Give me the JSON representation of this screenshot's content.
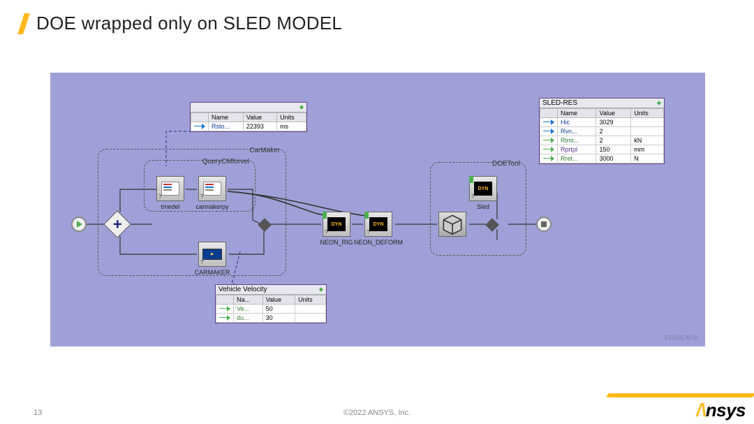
{
  "title": "DOE wrapped only on SLED MODEL",
  "footer": {
    "page": "13",
    "copy": "©2022 ANSYS, Inc."
  },
  "logo": {
    "brand": "nsys",
    "slash": "/\\"
  },
  "watermark": "PHOENIX",
  "groups": {
    "carmaker": "CarMaker",
    "query": "QueryCMforvel",
    "doe": "DOETool"
  },
  "nodes": {
    "tmedel": "tmedel",
    "carmakerpy": "carmakerpy",
    "carmaker": "CARMAKER",
    "neon_rig": "NEON_RIG",
    "neon_deform": "NEON_DEFORM",
    "sled": "Sled",
    "dyn": "DYN"
  },
  "tooltips": {
    "top": {
      "headers": [
        "Name",
        "Value",
        "Units"
      ],
      "rows": [
        {
          "dir": "in",
          "name": "Rsto...",
          "val": "22393",
          "units": "ms",
          "cls": "name"
        }
      ]
    },
    "velocity": {
      "title": "Vehicle Velocity",
      "headers": [
        "Na...",
        "Value",
        "Units"
      ],
      "rows": [
        {
          "dir": "out",
          "name": "Ve...",
          "val": "50",
          "units": "",
          "cls": "green"
        },
        {
          "dir": "out",
          "name": "du...",
          "val": "30",
          "units": "",
          "cls": "green"
        }
      ]
    },
    "sled": {
      "title": "SLED-RES",
      "headers": [
        "Name",
        "Value",
        "Units"
      ],
      "rows": [
        {
          "dir": "in",
          "name": "Hic",
          "val": "3029",
          "units": "",
          "cls": "name"
        },
        {
          "dir": "in",
          "name": "Rvn...",
          "val": "2",
          "units": "",
          "cls": "name"
        },
        {
          "dir": "out",
          "name": "Rlmt...",
          "val": "2",
          "units": "kN",
          "cls": "green"
        },
        {
          "dir": "out",
          "name": "Rprtpl",
          "val": "150",
          "units": "mm",
          "cls": "purple"
        },
        {
          "dir": "out",
          "name": "Rret...",
          "val": "3000",
          "units": "N",
          "cls": "green"
        }
      ]
    }
  }
}
